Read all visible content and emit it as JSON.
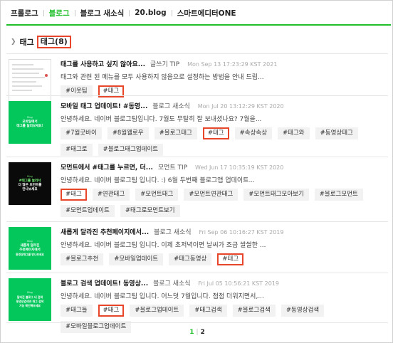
{
  "nav": {
    "items": [
      "프롤로그",
      "블로그",
      "블로그 새소식",
      "20.blog",
      "스마트에디터ONE"
    ],
    "active_index": 1
  },
  "tag_header": {
    "label": "태그",
    "count_label": "태그(8)"
  },
  "posts": [
    {
      "title": "태그를 사용하고 싶지 않아요...",
      "category": "글쓰기 TIP",
      "date": "Mon Sep 13 17:23:29 KST 2021",
      "excerpt": "태그와 관련 된 메뉴를 모두 사용하지 않음으로 설정하는 방법을 안내 드립...",
      "thumb": {
        "kind": "screenshot"
      },
      "tags": [
        "#이웃팁",
        "#태그"
      ],
      "highlight_index": 1
    },
    {
      "title": "모바일 태그 업데이트! #동영...",
      "category": "블로그 새소식",
      "date": "Mon Jul 20 13:12:29 KST 2020",
      "excerpt": "안녕하세요. 네이버 블로그팀입니다. 7월도 무탈히 잘 보내셨나요? 7월을...",
      "thumb": {
        "kind": "green",
        "small": "Blog",
        "lines": [
          "모바일에서",
          "태그를 눌러보세요!"
        ]
      },
      "tags": [
        "#7월굿바이",
        "#8월웰로우",
        "#블로그태그",
        "#태그",
        "#속상속상",
        "#태그와",
        "#동영상태그",
        "#태그로",
        "#블로그태그업데이트"
      ],
      "highlight_index": 3
    },
    {
      "title": "모먼트에서 #태그를 누르면, 더...",
      "category": "모먼트 TIP",
      "date": "Wed Jun 17 10:35:19 KST 2020",
      "excerpt": "안녕하세요. 네이버 블로그팀 입니다. :) 6월 두번째 블로그앱 업데이트...",
      "thumb": {
        "kind": "black",
        "small": "Blog",
        "lines": [
          "#태그를 눌러서",
          "더 많은 모먼트를",
          "만나보세요"
        ]
      },
      "tags": [
        "#태그",
        "#연관태그",
        "#모먼트태그",
        "#모먼트연관태그",
        "#모먼트태그모아보기",
        "#블로그모먼트",
        "#모먼트업데이트",
        "#태그로모먼트보기"
      ],
      "highlight_index": 0
    },
    {
      "title": "새롭게 달라진 추천페이지에서...",
      "category": "블로그 새소식",
      "date": "Fri Sep 06 10:16:27 KST 2019",
      "excerpt": "안녕하세요. 네이버 블로그팀 입니다. 이제 초저녁이면 날씨가 조금 쌀쌀한 ...",
      "thumb": {
        "kind": "green",
        "small": "Blog",
        "lines": [
          "새롭게 달라진",
          "추천페이지에서",
          "동영상태그를 만나보세요"
        ]
      },
      "tags": [
        "#블로그추천",
        "#모바일업데이트",
        "#태그동영상",
        "#태그"
      ],
      "highlight_index": 3
    },
    {
      "title": "블로그 검색 업데이트! 동영상...",
      "category": "블로그 새소식",
      "date": "Fri Jul 05 10:56:21 KST 2019",
      "excerpt": "안녕하세요. 네이버 블로그팀 입니다. 어느덧 7월입니다. 점점 더워지면서,...",
      "thumb": {
        "kind": "green",
        "small": "Blog",
        "lines": [
          "달라진 블로그 내 검색",
          "동영상검색과 태그 검색",
          "기능 확인해보세요"
        ]
      },
      "tags": [
        "#태그들",
        "#태그",
        "#블로그업데이트",
        "#태그검색",
        "#블로그검색",
        "#동영상검색",
        "#모바일블로그업데이트"
      ],
      "highlight_index": 1
    }
  ],
  "pagination": {
    "pages": [
      "1",
      "2"
    ],
    "current": "1"
  },
  "colors": {
    "accent": "#1fbf2a",
    "highlight": "#e8462a",
    "naver_green": "#03c75a"
  }
}
